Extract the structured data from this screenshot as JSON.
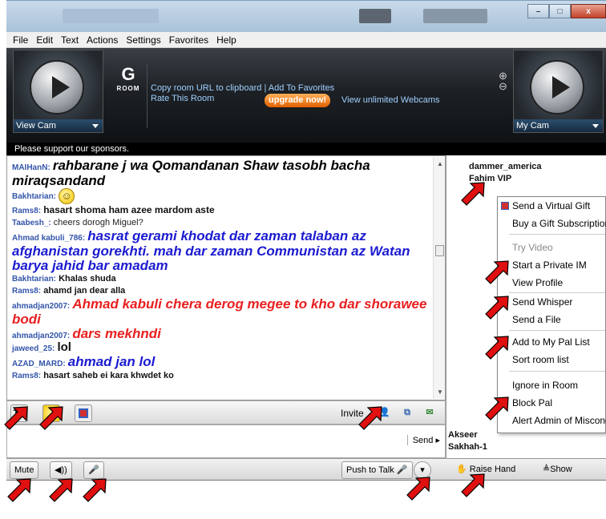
{
  "menubar": {
    "items": [
      "File",
      "Edit",
      "Text",
      "Actions",
      "Settings",
      "Favorites",
      "Help"
    ]
  },
  "window": {
    "minimize": "–",
    "maximize": "□",
    "close": "x"
  },
  "banner": {
    "left_cam": "View Cam",
    "right_cam": "My Cam",
    "room_letter": "G",
    "room_label": "ROOM",
    "copy_url": "Copy room URL to clipboard",
    "add_fav": "Add To Favorites",
    "rate": "Rate This Room",
    "upgrade": "upgrade now!",
    "unlimited": "View unlimited Webcams",
    "zoom_in": "⊕",
    "zoom_out": "⊖"
  },
  "sponsor": "Please support our sponsors.",
  "chat": [
    {
      "nick": "MAIHanN:",
      "text": "rahbarane j wa Qomandanan Shaw tasobh bacha miraqsandand"
    },
    {
      "nick": "Bakhtarian:",
      "text": "☺"
    },
    {
      "nick": "Rams8:",
      "text": "hasart shoma ham azee mardom aste"
    },
    {
      "nick": "Taabesh_:",
      "text": "cheers dorogh Miguel?"
    },
    {
      "nick": "Ahmad kabuli_786:",
      "text": "hasrat gerami khodat dar zaman talaban az afghanistan gorekhti. mah dar zaman Communistan az Watan barya jahid bar amadam"
    },
    {
      "nick": "Bakhtarian:",
      "text": "Khalas shuda"
    },
    {
      "nick": "Rams8:",
      "text": "ahamd jan dear alla"
    },
    {
      "nick": "ahmadjan2007:",
      "text": "Ahmad kabuli chera derog megee to kho dar shorawee bodi"
    },
    {
      "nick": "ahmadjan2007:",
      "text": "dars mekhndi"
    },
    {
      "nick": "jaweed_25:",
      "text": "lol"
    },
    {
      "nick": "AZAD_MARD:",
      "text": "ahmad jan lol"
    },
    {
      "nick": "Rams8:",
      "text": "hasart saheb ei kara khwdet ko"
    }
  ],
  "toolbar": {
    "text_btn": "T...",
    "invite": "Invite",
    "send": "Send ▸"
  },
  "bottom": {
    "mute": "Mute",
    "push_to_talk": "Push to Talk",
    "raise_hand": "Raise Hand",
    "show": "≜Show"
  },
  "users": [
    "dammer_america",
    "Fahim VIP",
    "Akseer",
    "Sakhah-1"
  ],
  "context_menu": [
    "Send a Virtual Gift",
    "Buy a Gift Subscription",
    "Try Video",
    "Start a Private IM",
    "View Profile",
    "Send Whisper",
    "Send a File",
    "Add to My Pal List",
    "Sort room list",
    "Ignore in Room",
    "Block Pal",
    "Alert Admin of Misconduct"
  ],
  "colors": {
    "arrow": "#e01010",
    "nick": "#3355aa",
    "blue_msg": "#1b1bd0",
    "red_msg": "#e82020"
  }
}
